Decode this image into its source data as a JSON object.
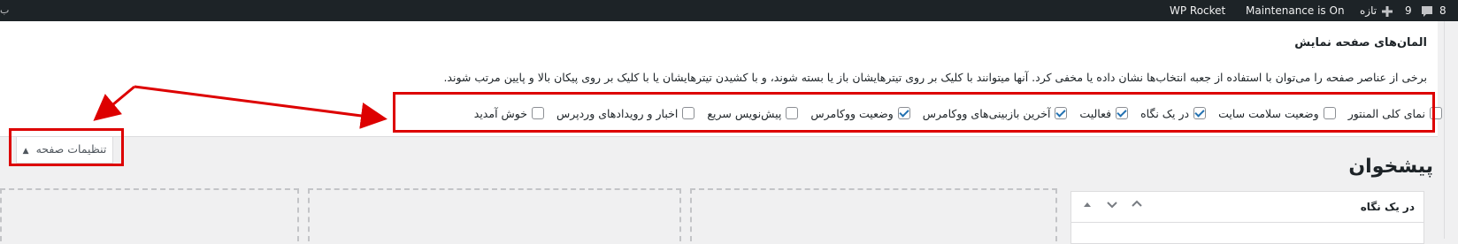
{
  "admin_bar": {
    "comment_count": "8",
    "updates_count": "9",
    "new_label": "تازه",
    "maintenance_label": "Maintenance is On",
    "wp_rocket_label": "WP Rocket",
    "edge_char": "ب"
  },
  "screen_options": {
    "title": "المان‌های صفحه نمایش",
    "description": "برخی از عناصر صفحه را می‌توان با استفاده از جعبه انتخاب‌ها نشان داده یا مخفی کرد. آنها میتوانند با کلیک بر روی تیترهایشان باز یا بسته شوند، و با کشیدن تیترهایشان یا با کلیک بر روی پیکان بالا و پایین مرتب شوند.",
    "checkboxes": [
      {
        "label": "نمای کلی المنتور",
        "checked": false
      },
      {
        "label": "وضعیت سلامت سایت",
        "checked": false
      },
      {
        "label": "در یک نگاه",
        "checked": true
      },
      {
        "label": "فعالیت",
        "checked": true
      },
      {
        "label": "آخرین بازبینی‌های ووکامرس",
        "checked": true
      },
      {
        "label": "وضعیت ووکامرس",
        "checked": true
      },
      {
        "label": "پیش‌نویس سریع",
        "checked": false
      },
      {
        "label": "اخبار و رویدادهای وردپرس",
        "checked": false
      },
      {
        "label": "خوش آمدید",
        "checked": false
      }
    ],
    "tab_label": "تنظیمات صفحه"
  },
  "page": {
    "heading": "پیشخوان",
    "widget_title": "در یک نگاه"
  },
  "colors": {
    "adminbar_bg": "#1d2327",
    "annotation_red": "#dd0000",
    "checkbox_accent": "#2271b1"
  }
}
